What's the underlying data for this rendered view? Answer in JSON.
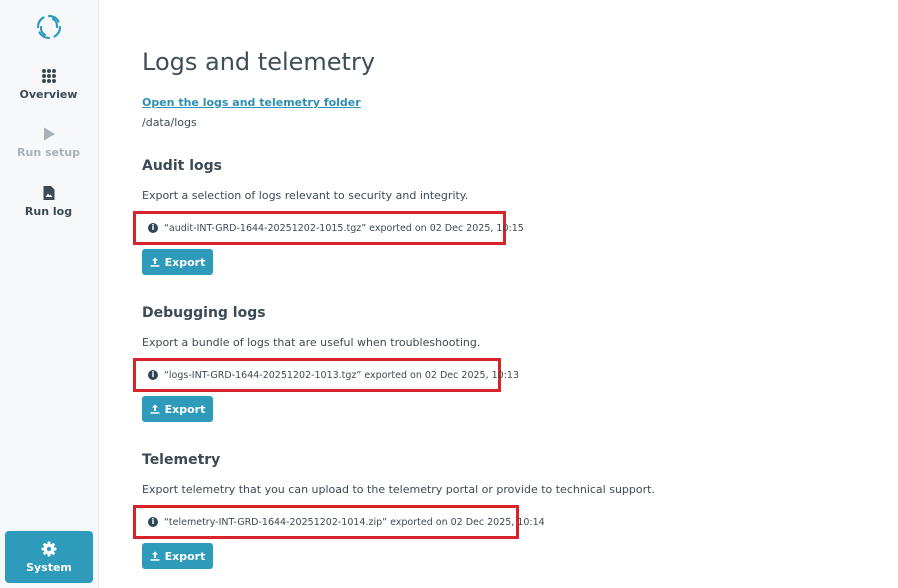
{
  "sidebar": {
    "items": [
      {
        "label": "Overview",
        "icon": "grid-icon",
        "enabled": true
      },
      {
        "label": "Run setup",
        "icon": "play-icon",
        "enabled": false
      },
      {
        "label": "Run log",
        "icon": "document-icon",
        "enabled": true
      }
    ],
    "system": {
      "label": "System",
      "icon": "gear-icon",
      "active": true
    }
  },
  "page": {
    "title": "Logs and telemetry",
    "folder_link": "Open the logs and telemetry folder",
    "folder_path": "/data/logs"
  },
  "sections": [
    {
      "title": "Audit logs",
      "description": "Export a selection of logs relevant to security and integrity.",
      "export_info": "“audit-INT-GRD-1644-20251202-1015.tgz” exported on 02 Dec 2025, 10:15",
      "button": "Export"
    },
    {
      "title": "Debugging logs",
      "description": "Export a bundle of logs that are useful when troubleshooting.",
      "export_info": "“logs-INT-GRD-1644-20251202-1013.tgz” exported on 02 Dec 2025, 10:13",
      "button": "Export"
    },
    {
      "title": "Telemetry",
      "description": "Export telemetry that you can upload to the telemetry portal or provide to technical support.",
      "export_info": "“telemetry-INT-GRD-1644-20251202-1014.zip” exported on 02 Dec 2025, 10:14",
      "button": "Export"
    }
  ],
  "colors": {
    "accent": "#2e9bbb",
    "link": "#2e8fb0",
    "highlight_box": "#d9232b",
    "text": "#3c4a55"
  }
}
